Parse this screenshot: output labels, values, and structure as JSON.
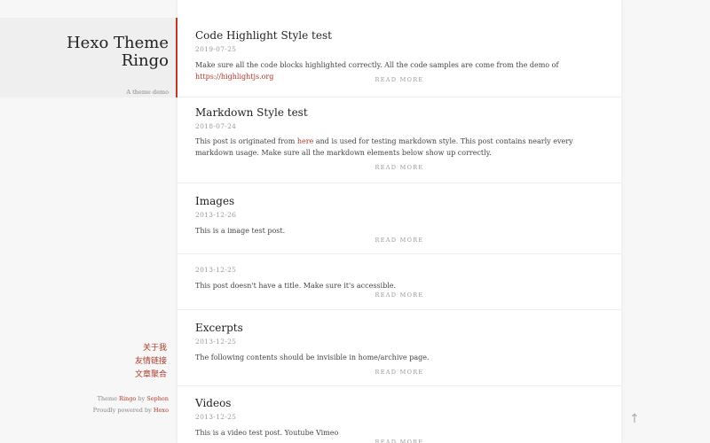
{
  "site": {
    "title_line1": "Hexo Theme",
    "title_line2": "Ringo",
    "description": "A theme demo"
  },
  "nav": [
    {
      "label": "关于我"
    },
    {
      "label": "友情链接"
    },
    {
      "label": "文章聚合"
    }
  ],
  "footer": {
    "theme_prefix": "Theme ",
    "theme_name": "Ringo",
    "by": " by ",
    "author": "Sephon",
    "powered_prefix": "Proudly powered by ",
    "powered_name": "Hexo"
  },
  "read_more_label": "READ MORE",
  "back_to_top_icon": "arrow-up-icon",
  "back_to_top_glyph": "↑",
  "posts": [
    {
      "title": "Code Highlight Style test",
      "date": "2019-07-25",
      "excerpt": "Make sure all the code blocks highlighted correctly. All the code samples are come from the demo of ",
      "link_text": "https://highlightjs.org",
      "excerpt_after": ""
    },
    {
      "title": "Markdown Style test",
      "date": "2018-07-24",
      "excerpt": "This post is originated from ",
      "link_text": "here",
      "excerpt_after": " and is used for testing markdown style. This post contains nearly every markdown usage. Make sure all the markdown elements below show up correctly."
    },
    {
      "title": "Images",
      "date": "2013-12-26",
      "excerpt": "This is a image test post.",
      "link_text": "",
      "excerpt_after": ""
    },
    {
      "title": "",
      "date": "2013-12-25",
      "excerpt": "This post doesn't have a title. Make sure it's accessible.",
      "link_text": "",
      "excerpt_after": ""
    },
    {
      "title": "Excerpts",
      "date": "2013-12-25",
      "excerpt": "The following contents should be invisible in home/archive page.",
      "link_text": "",
      "excerpt_after": ""
    },
    {
      "title": "Videos",
      "date": "2013-12-25",
      "excerpt": "This is a video test post. Youtube Vimeo",
      "link_text": "",
      "excerpt_after": ""
    }
  ],
  "colors": {
    "accent": "#b0392b",
    "background": "#f7f7f7",
    "card": "#ffffff"
  }
}
